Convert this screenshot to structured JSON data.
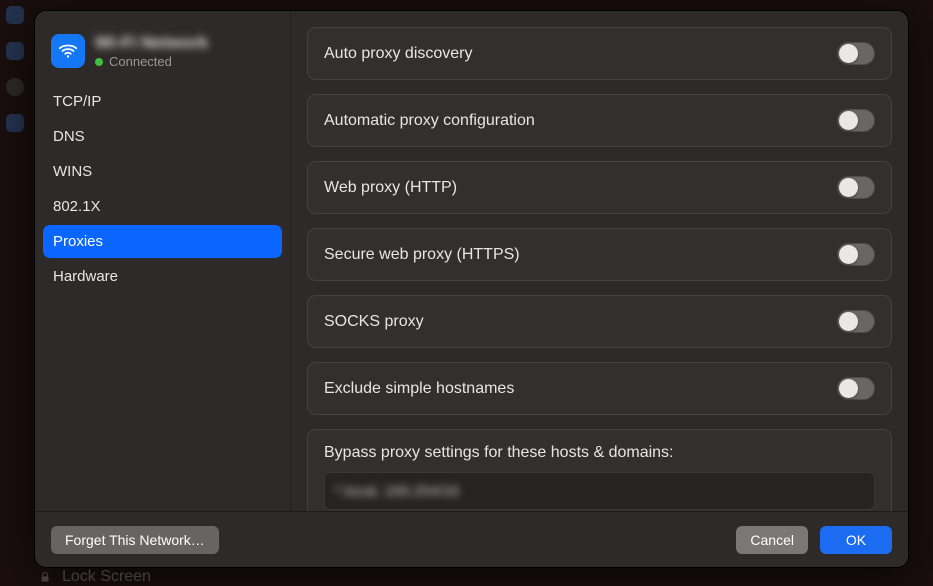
{
  "network": {
    "name": "Wi-Fi Network",
    "status_label": "Connected"
  },
  "sidebar": {
    "items": [
      {
        "label": "TCP/IP"
      },
      {
        "label": "DNS"
      },
      {
        "label": "WINS"
      },
      {
        "label": "802.1X"
      },
      {
        "label": "Proxies",
        "selected": true
      },
      {
        "label": "Hardware"
      }
    ]
  },
  "proxies": {
    "rows": [
      {
        "label": "Auto proxy discovery",
        "on": false
      },
      {
        "label": "Automatic proxy configuration",
        "on": false
      },
      {
        "label": "Web proxy (HTTP)",
        "on": false
      },
      {
        "label": "Secure web proxy (HTTPS)",
        "on": false
      },
      {
        "label": "SOCKS proxy",
        "on": false
      },
      {
        "label": "Exclude simple hostnames",
        "on": false
      }
    ],
    "bypass_label": "Bypass proxy settings for these hosts & domains:",
    "bypass_value": "*.local, 169.254/16"
  },
  "buttons": {
    "forget": "Forget This Network…",
    "cancel": "Cancel",
    "ok": "OK"
  },
  "behind": {
    "lock_label": "Lock Screen"
  }
}
